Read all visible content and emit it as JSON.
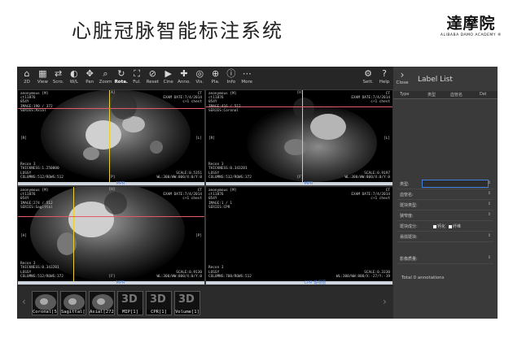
{
  "slide": {
    "title": "心脏冠脉智能标注系统"
  },
  "logo": {
    "name": "達摩院",
    "tagline": "ALIBABA DAMO ACADEMY ®"
  },
  "toolbar": {
    "left": [
      {
        "label": "2D",
        "icon": "home-icon",
        "glyph": "⌂"
      },
      {
        "label": "View",
        "icon": "grid-icon",
        "glyph": "▦"
      },
      {
        "label": "Scro.",
        "icon": "scroll-icon",
        "glyph": "⇄"
      },
      {
        "label": "W/L",
        "icon": "contrast-icon",
        "glyph": "◐"
      },
      {
        "label": "Pan",
        "icon": "pan-icon",
        "glyph": "✥"
      },
      {
        "label": "Zoom",
        "icon": "zoom-icon",
        "glyph": "⌕"
      },
      {
        "label": "Rota.",
        "icon": "rotate-icon",
        "glyph": "↻",
        "active": true
      },
      {
        "label": "Ful.",
        "icon": "fullscreen-icon",
        "glyph": "⛶"
      },
      {
        "label": "Reset",
        "icon": "reset-icon",
        "glyph": "⊘"
      },
      {
        "label": "Cine",
        "icon": "cine-play-icon",
        "glyph": "▶"
      },
      {
        "label": "Anno.",
        "icon": "annotation-icon",
        "glyph": "✚"
      },
      {
        "label": "Vis.",
        "icon": "visibility-icon",
        "glyph": "◎"
      },
      {
        "label": "Pla.",
        "icon": "plane-icon",
        "glyph": "⊕"
      },
      {
        "label": "Info",
        "icon": "info-icon",
        "glyph": "ⓘ"
      },
      {
        "label": "More",
        "icon": "more-icon",
        "glyph": "⋯"
      }
    ],
    "right": [
      {
        "label": "Sett.",
        "icon": "settings-gear-icon",
        "glyph": "⚙"
      },
      {
        "label": "Help",
        "icon": "help-icon",
        "glyph": "?"
      }
    ]
  },
  "viewports": [
    {
      "name": "axial",
      "tl": "anonymous [M]\nct11876\n054Y\nIMAGE:190 / 372\nSERIES:Axial",
      "tr": "CT\nEXAM DATE:7/4/2014\nc+1 chest",
      "bl": "Recon 3\nTHICKNESS:1.250000\nLOSSY\nCOLUMNS:512/ROWS:512",
      "br": "SCALE:0.5351\nWL:300/WW:800/X:0/Y:0",
      "ml": "[R]",
      "mr": "[L]",
      "mt": "[A]",
      "mb": "[P]",
      "mpr": "MPR"
    },
    {
      "name": "coronal",
      "tl": "anonymous [M]\nct11876\n054Y\nIMAGE:416 / 512\nSERIES:Coronal",
      "tr": "CT\nEXAM DATE:7/4/2014\nc+1 chest",
      "bl": "Recon 3\nTHICKNESS:0.343281\nLOSSY\nCOLUMNS:512/ROWS:372",
      "br": "SCALE:0.9197\nWL:300/WW:800/X:0/Y:0",
      "ml": "[R]",
      "mr": "[L]",
      "mt": "[H]",
      "mb": "[F]",
      "mpr": "MPR"
    },
    {
      "name": "sagittal",
      "tl": "anonymous [M]\nct11876\n054Y\nIMAGE:274 / 512\nSERIES:Sagittal",
      "tr": "CT\nEXAM DATE:7/4/2014\nc+1 chest",
      "bl": "Recon 3\nTHICKNESS:0.343281\nLOSSY\nCOLUMNS:512/ROWS:372",
      "br": "SCALE:0.9130\nWL:300/WW:800/X:0/Y:0",
      "ml": "[A]",
      "mr": "[P]",
      "mt": "[H]",
      "mb": "[F]",
      "mpr": "MPR"
    },
    {
      "name": "cpr",
      "tl": "anonymous [M]\nct11876\n054Y\nIMAGE:1 / 1\nSERIES:CPR",
      "tr": "CT\nEXAM DATE:7/4/2014\nc+1 chest",
      "bl": "Recon 3\nLOSSY\nCOLUMNS:708/ROWS:512",
      "br": "SCALE:0.3330\nWL:300/WW:800/X:-27/Y:-19",
      "ml": "",
      "mr": "",
      "mt": "",
      "mb": "",
      "mpr": "CPR 轴视图"
    }
  ],
  "label_panel": {
    "close_label": "Close",
    "title": "Label List",
    "columns": [
      "Type",
      "类型",
      "血管名",
      "Del"
    ],
    "fields": [
      {
        "label": "类型:",
        "selected": true
      },
      {
        "label": "血管名:"
      },
      {
        "label": "斑块类型:"
      },
      {
        "label": "狭窄度:"
      },
      {
        "label": "斑块成分:",
        "options": [
          "钙化",
          "纤维"
        ]
      },
      {
        "label": "易损斑块:"
      },
      {
        "label": "影像质量:"
      }
    ],
    "total": "Total 0 annotations"
  },
  "series_strip": [
    {
      "label": "Coronal[512]"
    },
    {
      "label": "Sagittal[512]"
    },
    {
      "label": "Axial[272]"
    },
    {
      "label": "MIP[1]",
      "is3d": true
    },
    {
      "label": "CPR[1]",
      "is3d": true
    },
    {
      "label": "Volume[1]",
      "is3d": true
    }
  ],
  "colors": {
    "app_bg": "#1b1b1b",
    "crosshair_h": "#e35a62",
    "crosshair_v": "#e8d230",
    "accent": "#3f7fe0"
  }
}
